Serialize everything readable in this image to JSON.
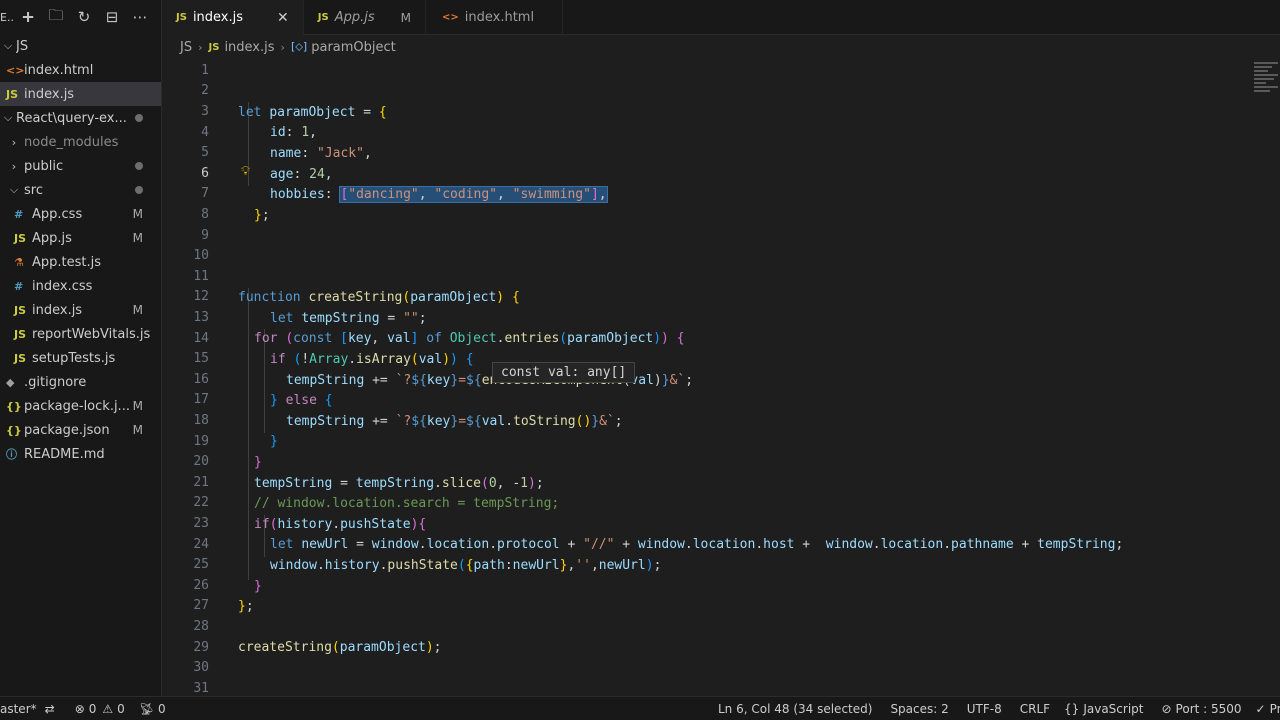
{
  "sidebar": {
    "toolbar_title": "E...",
    "toolbar_icons": [
      "new-file-icon",
      "new-folder-icon",
      "refresh-icon",
      "collapse-all-icon",
      "more-icon"
    ],
    "root_label": "JS",
    "items": [
      {
        "label": "index.html",
        "icon": "html-file-icon",
        "badge": ""
      },
      {
        "label": "index.js",
        "icon": "js-file-icon",
        "badge": ""
      },
      {
        "label": "React\\query-ex...",
        "icon": "folder-icon",
        "badge": ""
      },
      {
        "label": "node_modules",
        "icon": "folder-icon",
        "badge": ""
      },
      {
        "label": "public",
        "icon": "folder-icon",
        "badge": ""
      },
      {
        "label": "src",
        "icon": "folder-icon",
        "badge": ""
      },
      {
        "label": "App.css",
        "icon": "css-file-icon",
        "badge": "M"
      },
      {
        "label": "App.js",
        "icon": "js-file-icon",
        "badge": "M"
      },
      {
        "label": "App.test.js",
        "icon": "js-file-icon",
        "badge": ""
      },
      {
        "label": "index.css",
        "icon": "css-file-icon",
        "badge": ""
      },
      {
        "label": "index.js",
        "icon": "js-file-icon",
        "badge": "M"
      },
      {
        "label": "reportWebVitals.js",
        "icon": "js-file-icon",
        "badge": ""
      },
      {
        "label": "setupTests.js",
        "icon": "js-file-icon",
        "badge": ""
      },
      {
        "label": ".gitignore",
        "icon": "git-file-icon",
        "badge": ""
      },
      {
        "label": "package-lock.j...",
        "icon": "json-file-icon",
        "badge": "M"
      },
      {
        "label": "package.json",
        "icon": "json-file-icon",
        "badge": "M"
      },
      {
        "label": "README.md",
        "icon": "info-file-icon",
        "badge": ""
      }
    ]
  },
  "tabs": [
    {
      "label": "index.js",
      "icon_text": "JS",
      "modified": "",
      "active": true
    },
    {
      "label": "App.js",
      "icon_text": "JS",
      "modified": "M",
      "active": false
    },
    {
      "label": "index.html",
      "icon_text": "<>",
      "modified": "",
      "active": false
    }
  ],
  "breadcrumb": {
    "folder": "JS",
    "file_icon": "JS",
    "file": "index.js",
    "symbol": "paramObject"
  },
  "editor": {
    "line_numbers": [
      "1",
      "2",
      "3",
      "4",
      "5",
      "6",
      "7",
      "8",
      "9",
      "10",
      "11",
      "12",
      "13",
      "14",
      "15",
      "16",
      "17",
      "18",
      "19",
      "20",
      "21",
      "22",
      "23",
      "24",
      "25",
      "26",
      "27",
      "28",
      "29",
      "30",
      "31"
    ],
    "current_line": "6",
    "hover_text": "const val: any[]"
  },
  "statusbar": {
    "branch": "aster*",
    "errors": "0",
    "warnings": "0",
    "ports": "0",
    "cursor": "Ln 6, Col 48 (34 selected)",
    "spaces": "Spaces: 2",
    "encoding": "UTF-8",
    "eol": "CRLF",
    "language": "JavaScript",
    "port": "Port : 5500",
    "prettier": "Pre"
  },
  "colors": {
    "background": "#1e1e1e",
    "sidebar": "#181818",
    "selection": "#264f78",
    "keyword": "#569cd6",
    "string": "#ce9178"
  }
}
